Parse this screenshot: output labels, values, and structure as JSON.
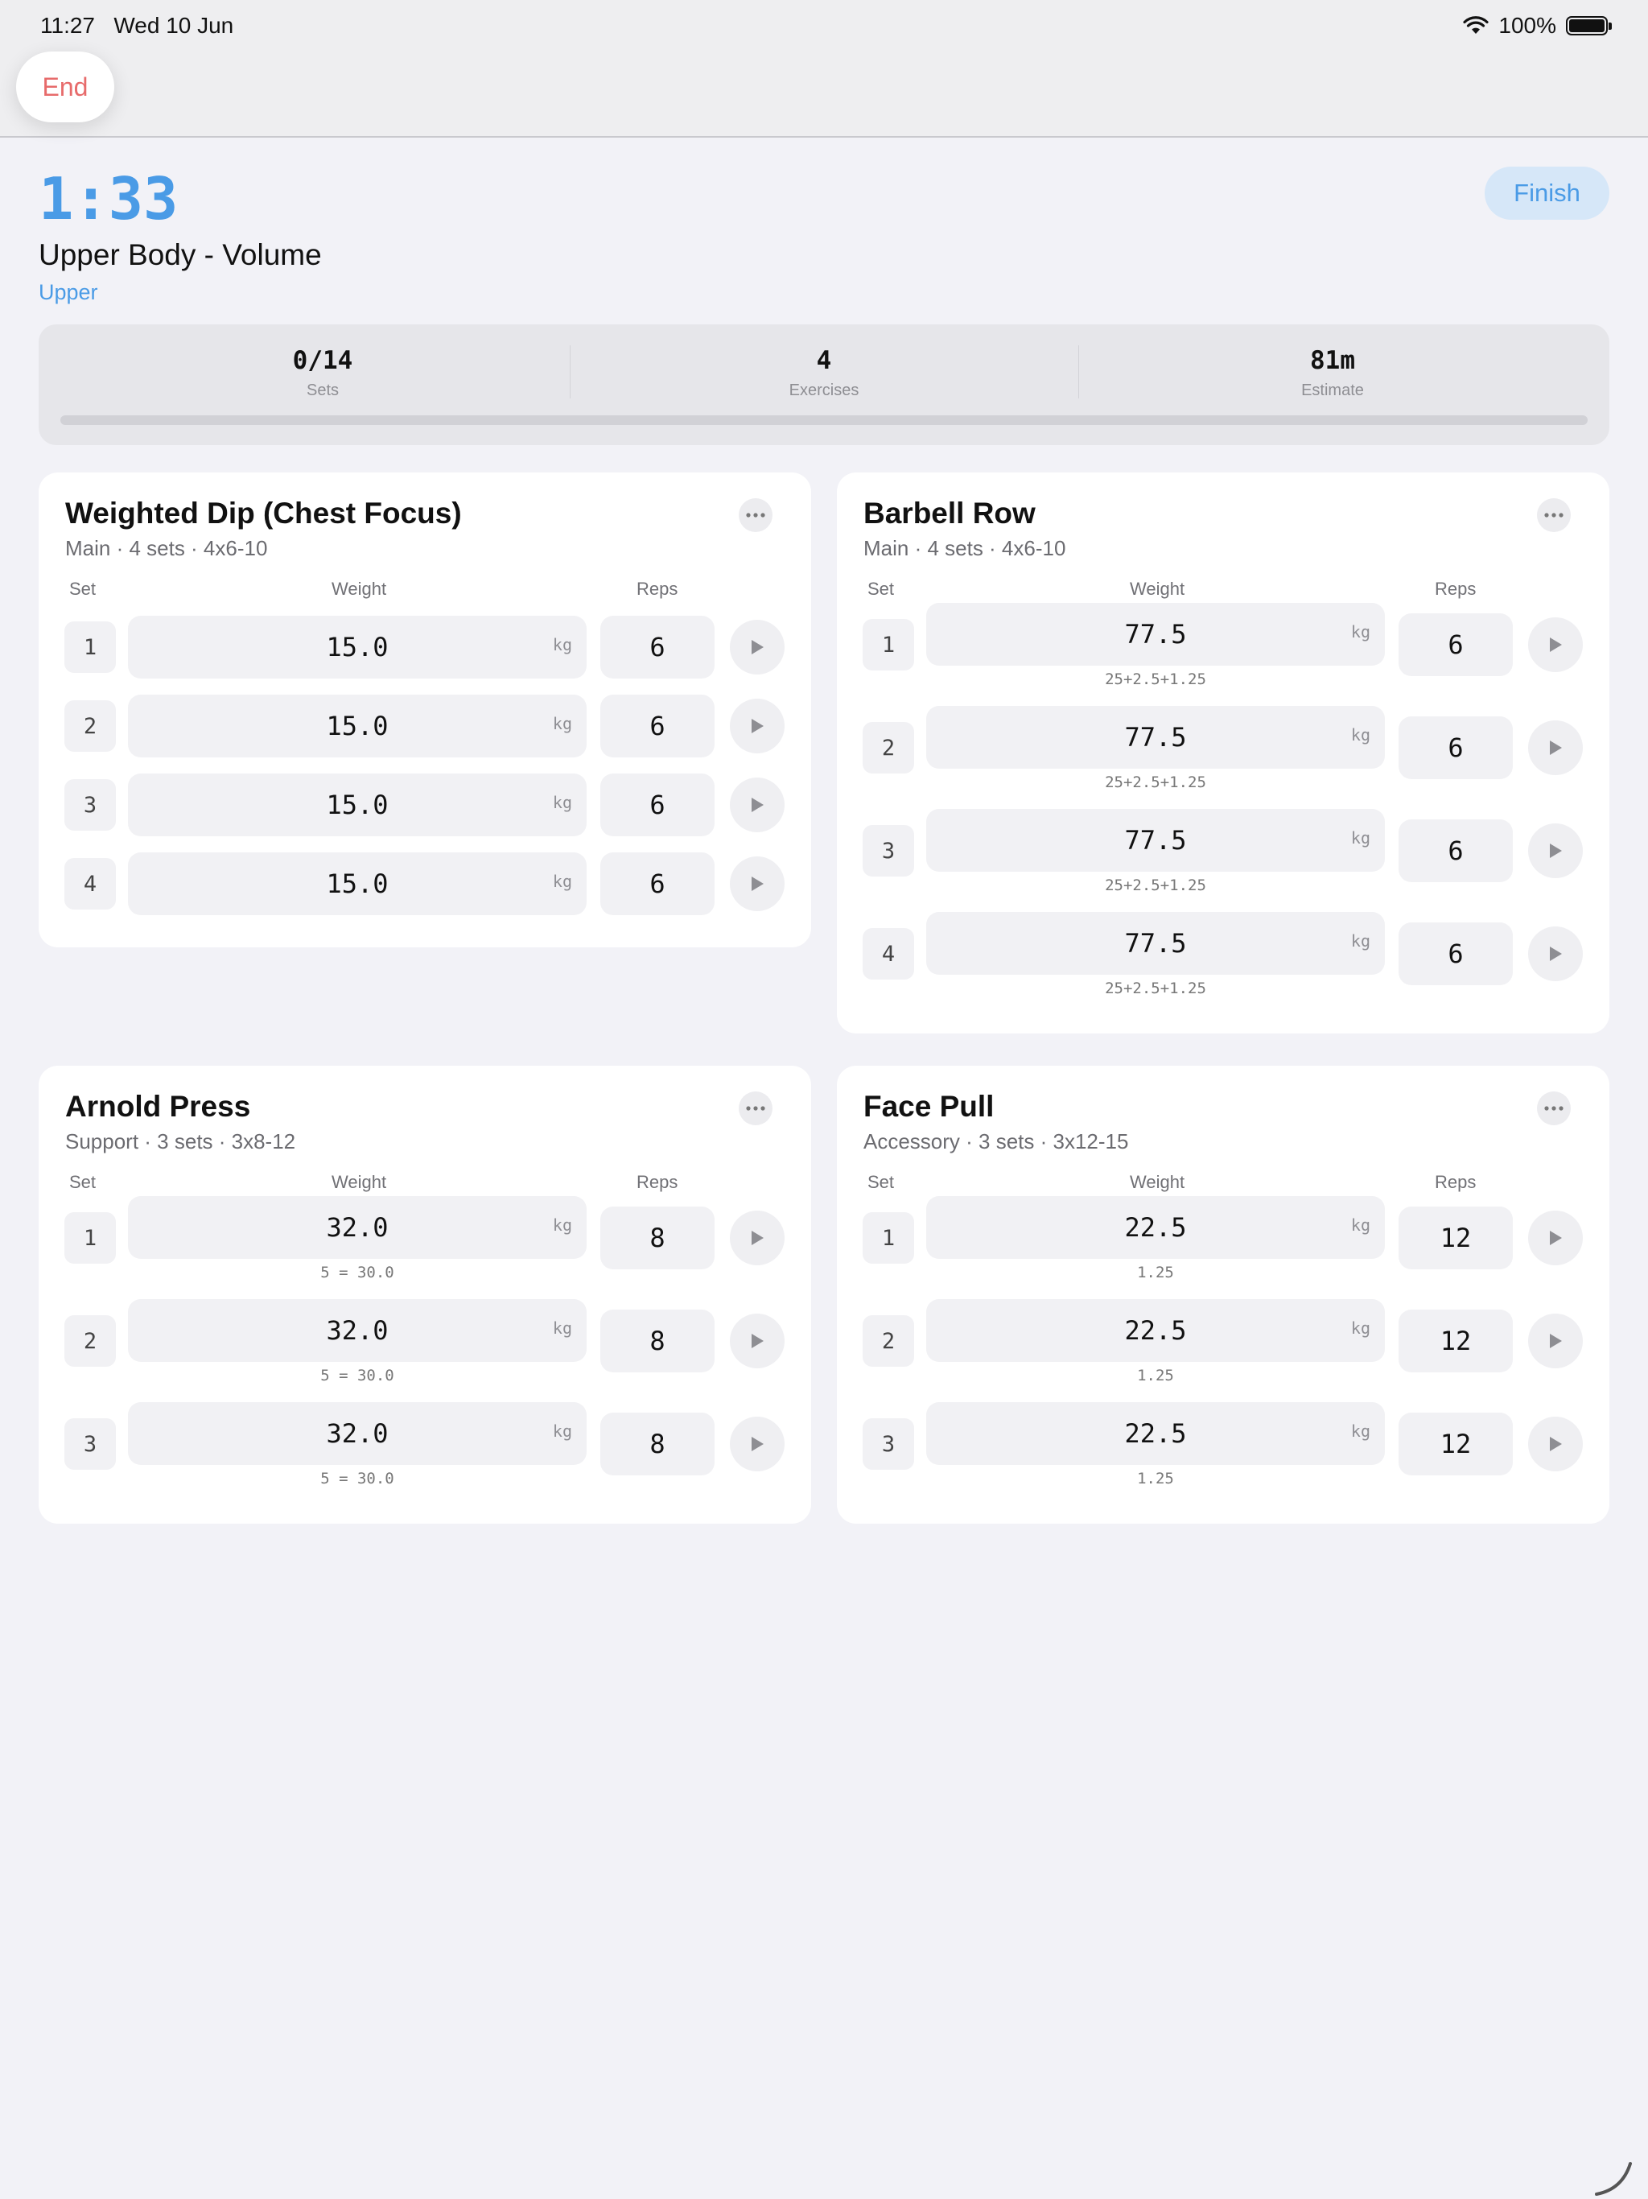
{
  "status_bar": {
    "time": "11:27",
    "date": "Wed 10 Jun",
    "battery": "100%"
  },
  "nav": {
    "end_label": "End"
  },
  "header": {
    "timer": "1:33",
    "title": "Upper Body - Volume",
    "tag": "Upper",
    "finish_label": "Finish"
  },
  "stats": {
    "sets": {
      "value": "0/14",
      "label": "Sets"
    },
    "exercises": {
      "value": "4",
      "label": "Exercises"
    },
    "estimate": {
      "value": "81m",
      "label": "Estimate"
    },
    "progress_fraction": 0
  },
  "columns": {
    "set": "Set",
    "weight": "Weight",
    "reps": "Reps"
  },
  "unit": "kg",
  "colors": {
    "accent": "#4a9be6",
    "danger": "#e76b6b"
  },
  "exercises": [
    {
      "name": "Weighted Dip (Chest Focus)",
      "subtitle": "Main · 4 sets · 4x6-10",
      "sets": [
        {
          "num": "1",
          "weight": "15.0",
          "reps": "6",
          "note": ""
        },
        {
          "num": "2",
          "weight": "15.0",
          "reps": "6",
          "note": ""
        },
        {
          "num": "3",
          "weight": "15.0",
          "reps": "6",
          "note": ""
        },
        {
          "num": "4",
          "weight": "15.0",
          "reps": "6",
          "note": ""
        }
      ]
    },
    {
      "name": "Barbell Row",
      "subtitle": "Main · 4 sets · 4x6-10",
      "sets": [
        {
          "num": "1",
          "weight": "77.5",
          "reps": "6",
          "note": "25+2.5+1.25"
        },
        {
          "num": "2",
          "weight": "77.5",
          "reps": "6",
          "note": "25+2.5+1.25"
        },
        {
          "num": "3",
          "weight": "77.5",
          "reps": "6",
          "note": "25+2.5+1.25"
        },
        {
          "num": "4",
          "weight": "77.5",
          "reps": "6",
          "note": "25+2.5+1.25"
        }
      ]
    },
    {
      "name": "Arnold Press",
      "subtitle": "Support · 3 sets · 3x8-12",
      "sets": [
        {
          "num": "1",
          "weight": "32.0",
          "reps": "8",
          "note": "5 = 30.0"
        },
        {
          "num": "2",
          "weight": "32.0",
          "reps": "8",
          "note": "5 = 30.0"
        },
        {
          "num": "3",
          "weight": "32.0",
          "reps": "8",
          "note": "5 = 30.0"
        }
      ]
    },
    {
      "name": "Face Pull",
      "subtitle": "Accessory · 3 sets · 3x12-15",
      "sets": [
        {
          "num": "1",
          "weight": "22.5",
          "reps": "12",
          "note": "1.25"
        },
        {
          "num": "2",
          "weight": "22.5",
          "reps": "12",
          "note": "1.25"
        },
        {
          "num": "3",
          "weight": "22.5",
          "reps": "12",
          "note": "1.25"
        }
      ]
    }
  ]
}
